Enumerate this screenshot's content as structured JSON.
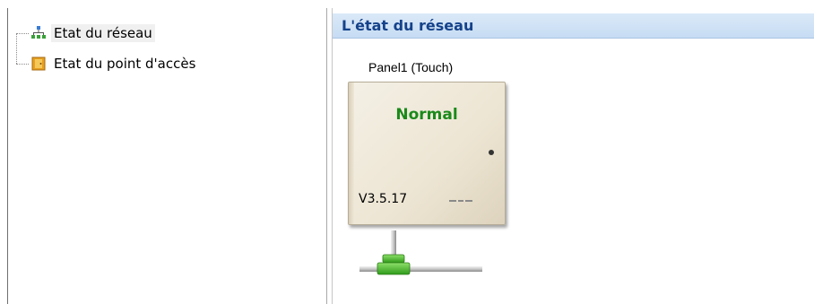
{
  "tree": {
    "items": [
      {
        "label": "Etat du réseau",
        "icon": "network-icon",
        "selected": true
      },
      {
        "label": "Etat du point d'accès",
        "icon": "door-icon",
        "selected": false
      }
    ]
  },
  "header": {
    "title": "L'état du réseau"
  },
  "panel": {
    "name": "Panel1 (Touch)",
    "status": "Normal",
    "version": "V3.5.17"
  },
  "colors": {
    "header_text": "#15428b",
    "status_green": "#1a8a1a",
    "pipe_green": "#44bb22"
  }
}
